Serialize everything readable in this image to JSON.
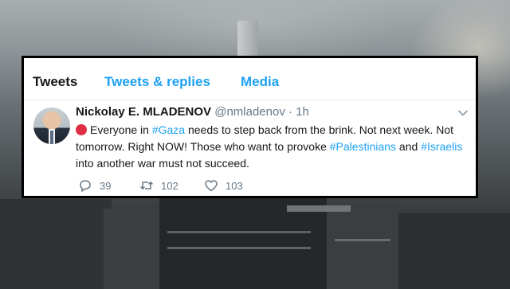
{
  "tabs": [
    {
      "label": "Tweets"
    },
    {
      "label": "Tweets & replies"
    },
    {
      "label": "Media"
    }
  ],
  "tweet": {
    "author_name": "Nickolay E. MLADENOV",
    "handle": "@nmladenov",
    "separator": "·",
    "time": "1h",
    "text": {
      "p1": "Everyone in ",
      "tag1": "#Gaza",
      "p2": " needs to step back from the brink. Not next week. Not tomorrow. Right NOW! Those who want to provoke ",
      "tag2": "#Palestinians",
      "p3": " and ",
      "tag3": "#Israelis",
      "p4": " into another war must not succeed."
    },
    "emoji": "red-circle",
    "counts": {
      "replies": "39",
      "retweets": "102",
      "likes": "103"
    }
  },
  "colors": {
    "accent": "#1da1f2",
    "text": "#14171a",
    "muted": "#657786",
    "red_circle": "#dd2e44"
  },
  "icons": [
    "reply-icon",
    "retweet-icon",
    "like-icon",
    "chevron-down-icon"
  ]
}
